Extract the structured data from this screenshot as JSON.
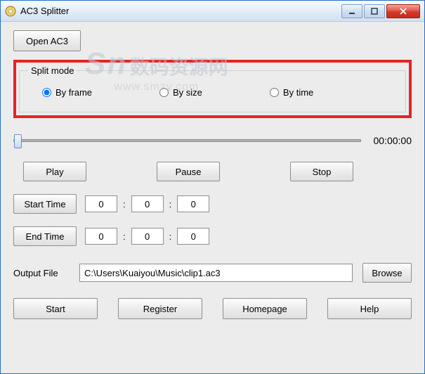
{
  "title": "AC3 Splitter",
  "watermark": {
    "logo": "Sn",
    "cn": "数码资源网",
    "url": "www.smzy.com"
  },
  "open_button": "Open AC3",
  "split_mode": {
    "legend": "Split mode",
    "by_frame": "By frame",
    "by_size": "By size",
    "by_time": "By time",
    "selected": "by_frame"
  },
  "slider": {
    "time": "00:00:00"
  },
  "media": {
    "play": "Play",
    "pause": "Pause",
    "stop": "Stop"
  },
  "start_time": {
    "label": "Start Time",
    "h": "0",
    "m": "0",
    "s": "0"
  },
  "end_time": {
    "label": "End Time",
    "h": "0",
    "m": "0",
    "s": "0"
  },
  "output": {
    "label": "Output File",
    "path": "C:\\Users\\Kuaiyou\\Music\\clip1.ac3",
    "browse": "Browse"
  },
  "bottom": {
    "start": "Start",
    "register": "Register",
    "homepage": "Homepage",
    "help": "Help"
  }
}
